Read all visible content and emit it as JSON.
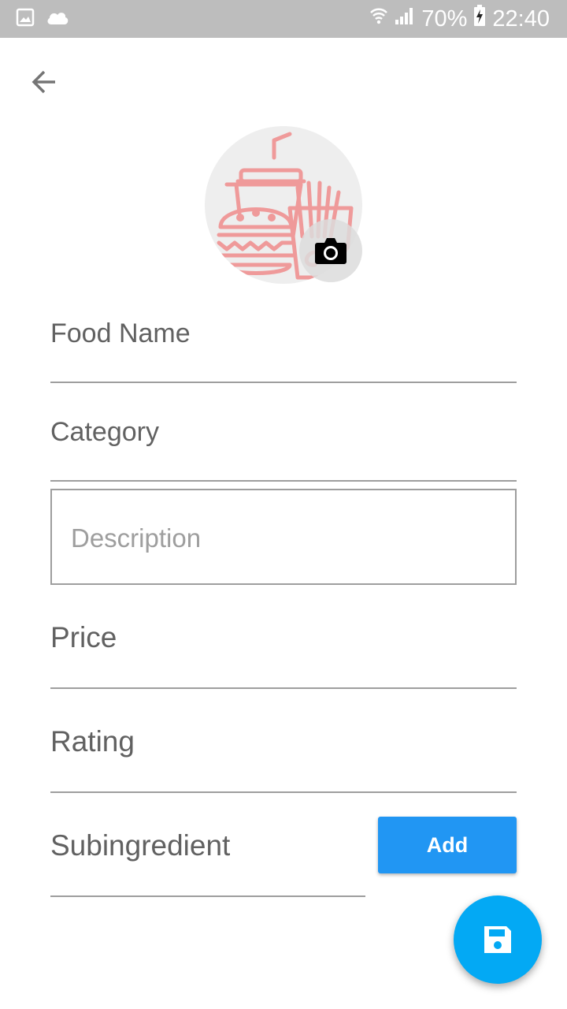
{
  "status_bar": {
    "battery": "70%",
    "time": "22:40",
    "icons": [
      "image-icon",
      "cloud-icon",
      "wifi-icon",
      "signal-icon",
      "battery-charging-icon"
    ]
  },
  "toolbar": {
    "back_icon": "arrow-back-icon"
  },
  "avatar": {
    "image": "fast-food-icon",
    "badge_icon": "camera-icon"
  },
  "form": {
    "food_name_label": "Food Name",
    "category_label": "Category",
    "description_placeholder": "Description",
    "price_label": "Price",
    "rating_label": "Rating",
    "subingredient_label": "Subingredient",
    "add_button_label": "Add"
  },
  "fab": {
    "icon": "save-icon"
  },
  "colors": {
    "status_bar": "#bdbdbd",
    "accent": "#2196f3",
    "fab": "#03a9f4",
    "illustration": "#ef9a9a",
    "label": "#616161",
    "underline": "#9e9e9e"
  }
}
